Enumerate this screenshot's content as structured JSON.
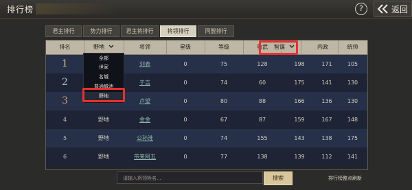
{
  "header": {
    "title": "排行榜",
    "back_label": "返回",
    "help_icon": "?"
  },
  "tabs": [
    {
      "label": "君主排行",
      "active": false
    },
    {
      "label": "势力排行",
      "active": false
    },
    {
      "label": "君主将排行",
      "active": false
    },
    {
      "label": "将领排行",
      "active": true
    },
    {
      "label": "同盟排行",
      "active": false
    }
  ],
  "table": {
    "columns": [
      "排名",
      "野地",
      "将领",
      "星级",
      "等级",
      "勇武",
      "智谋",
      "内政",
      "统帅"
    ],
    "rows": [
      {
        "rank": "1",
        "location": "",
        "name": "刘表",
        "stars": "0",
        "level": "75",
        "valor": "128",
        "wisdom": "198",
        "politics": "171",
        "command": "105"
      },
      {
        "rank": "2",
        "location": "",
        "name": "于吉",
        "stars": "0",
        "level": "74",
        "valor": "60",
        "wisdom": "175",
        "politics": "141",
        "command": "130"
      },
      {
        "rank": "3",
        "location": "",
        "name": "卢望",
        "stars": "0",
        "level": "80",
        "valor": "88",
        "wisdom": "166",
        "politics": "136",
        "command": "130"
      },
      {
        "rank": "4",
        "location": "野地",
        "name": "金金",
        "stars": "0",
        "level": "67",
        "valor": "87",
        "wisdom": "159",
        "politics": "167",
        "command": "148"
      },
      {
        "rank": "5",
        "location": "野地",
        "name": "公孙淮",
        "stars": "0",
        "level": "74",
        "valor": "155",
        "wisdom": "143",
        "politics": "138",
        "command": "175"
      },
      {
        "rank": "6",
        "location": "野地",
        "name": "带来阿五",
        "stars": "0",
        "level": "77",
        "valor": "138",
        "wisdom": "139",
        "politics": "112",
        "command": "141"
      }
    ]
  },
  "filter_dropdown": {
    "options": [
      "全部",
      "世家",
      "名城",
      "普通城池",
      "野地"
    ],
    "selected": "野地"
  },
  "search": {
    "placeholder": "请输入将领姓名...",
    "button_label": "搜索"
  },
  "footer_note": "排行榜整点刷新",
  "colors": {
    "highlight": "#e8312f",
    "header_bg": "#bfb7a5",
    "active_tab": "#d6d0bf",
    "search_button": "#d8c59a"
  }
}
